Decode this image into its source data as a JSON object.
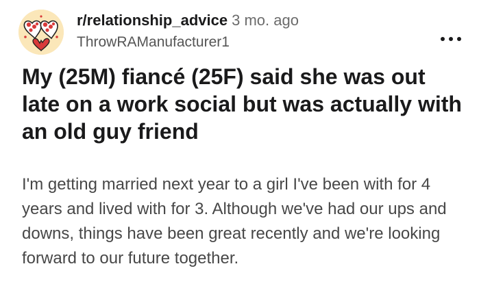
{
  "post": {
    "subreddit": "r/relationship_advice",
    "age": "3 mo. ago",
    "author": "ThrowRAManufacturer1",
    "title": "My (25M) fiancé (25F) said she was out late on a work social but was actually with an old guy friend",
    "body": "I'm getting married next year to a girl I've been with for 4 years and lived with for 3. Although we've had our ups and downs, things have been great recently and we're looking forward to our future together."
  },
  "icons": {
    "avatar": "community-avatar-icon",
    "more": "more-options-icon"
  },
  "colors": {
    "avatar_bg": "#fbe7b9",
    "heart_red": "#d93a3a",
    "text_primary": "#1a1a1b",
    "text_secondary": "#474747"
  }
}
